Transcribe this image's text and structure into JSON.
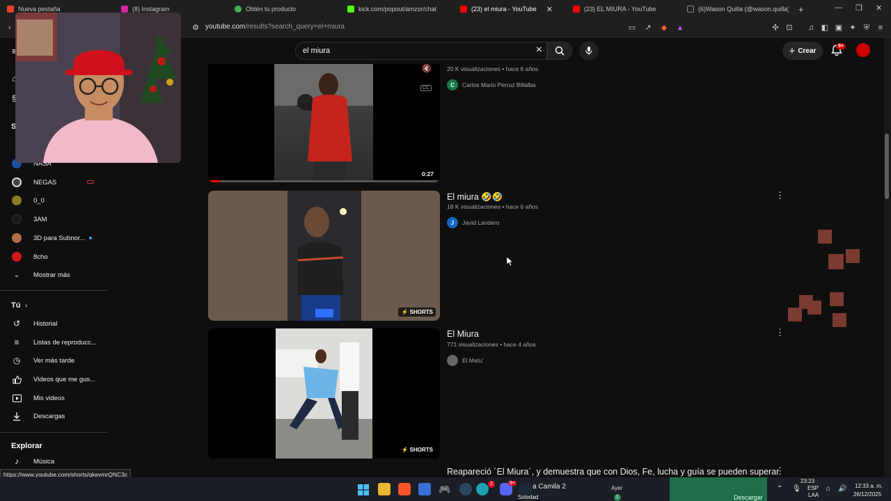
{
  "browser": {
    "tabs": [
      {
        "label": "Nueva pestaña",
        "favicon_color": "#e8432e"
      },
      {
        "label": "(8) Instagram",
        "favicon_color": "#d6249f"
      },
      {
        "label": "Obtén tu producto",
        "favicon_color": "#4caf50"
      },
      {
        "label": "kick.com/popout/amzor/chat",
        "favicon_color": "#53fc18"
      },
      {
        "label": "(23) el miura - YouTube",
        "favicon_color": "#ff0000",
        "active": true
      },
      {
        "label": "(23) EL MIURA - YouTube",
        "favicon_color": "#ff0000"
      },
      {
        "label": "(6)Wason Quilla (@wason.quilla) | Ti",
        "favicon_color": "#ffffff"
      }
    ],
    "close_tab_glyph": "✕",
    "new_tab_glyph": "+",
    "window_controls": [
      "—",
      "❐",
      "✕"
    ],
    "url_host": "youtube.com",
    "url_path": "/results?search_query=el+miura"
  },
  "youtube": {
    "search_value": "el miura",
    "create_label": "Crear",
    "notifications_badge": "9+"
  },
  "sidebar": {
    "section_header_partial": "S",
    "channels": [
      {
        "label": "NASA",
        "color": "#1e4fa3",
        "live": false,
        "muted": true
      },
      {
        "label": "NEGAS",
        "color": "#444",
        "live": false
      },
      {
        "label": "0_0",
        "color": "#8a7a2a",
        "live": false
      },
      {
        "label": "3AM",
        "color": "#1a1a1a",
        "live": false
      },
      {
        "label": "3D para Subnor...",
        "color": "#b06f4a",
        "live": true
      },
      {
        "label": "8cho",
        "color": "#d01818",
        "live": false
      }
    ],
    "show_more": "Mostrar más",
    "you_header": "Tú",
    "you_items": [
      {
        "label": "Historial",
        "icon": "history-icon",
        "glyph": "↺"
      },
      {
        "label": "Listas de reproducc...",
        "icon": "playlist-icon",
        "glyph": "≡"
      },
      {
        "label": "Ver más tarde",
        "icon": "clock-icon",
        "glyph": "◷"
      },
      {
        "label": "Videos que me gus...",
        "icon": "thumbs-up-icon",
        "glyph": "👍"
      },
      {
        "label": "Mis videos",
        "icon": "video-icon",
        "glyph": "▷"
      },
      {
        "label": "Descargas",
        "icon": "download-icon",
        "glyph": "⤓"
      }
    ],
    "explore_header": "Explorar",
    "explore_items": [
      {
        "label": "Música",
        "icon": "music-icon",
        "glyph": "♪"
      }
    ]
  },
  "results": [
    {
      "title": "",
      "views": "20 K visualizaciones",
      "age": "hace 6 años",
      "channel": "Carlos Mario Perruz Billalba",
      "channel_initial": "C",
      "channel_color": "#1b7a4b",
      "duration": "0:27",
      "progress": 0.05
    },
    {
      "title": "El miura 🤣🤣",
      "views": "18 K visualizaciones",
      "age": "hace 6 años",
      "channel": "Javid Landero",
      "channel_initial": "J",
      "channel_color": "#1565c0",
      "badge": "SHORTS"
    },
    {
      "title": "El Miura",
      "views": "771 visualizaciones",
      "age": "hace 4 años",
      "channel": "El Matu'",
      "channel_initial": "",
      "channel_color": "#666",
      "badge": "SHORTS"
    },
    {
      "title": "Reapareció ´El Miura´, y demuestra que con Dios, Fe, lucha y guía se pueden superar"
    }
  ],
  "status_url": "https://www.youtube.com/shorts/qkevmrQNC3c",
  "taskbar": {
    "media_title": "a Camila 2",
    "media_subtitle": "Soledad",
    "weather_day": "Ayer",
    "download_label": "Descargar",
    "recording_time": "23:23",
    "lang_top": "ESP",
    "lang_bottom": "LAA",
    "time": "12:33 a. m.",
    "date": "26/12/2025",
    "discord_badge": "9+",
    "browser_badge": "2",
    "weather_badge": "1"
  }
}
